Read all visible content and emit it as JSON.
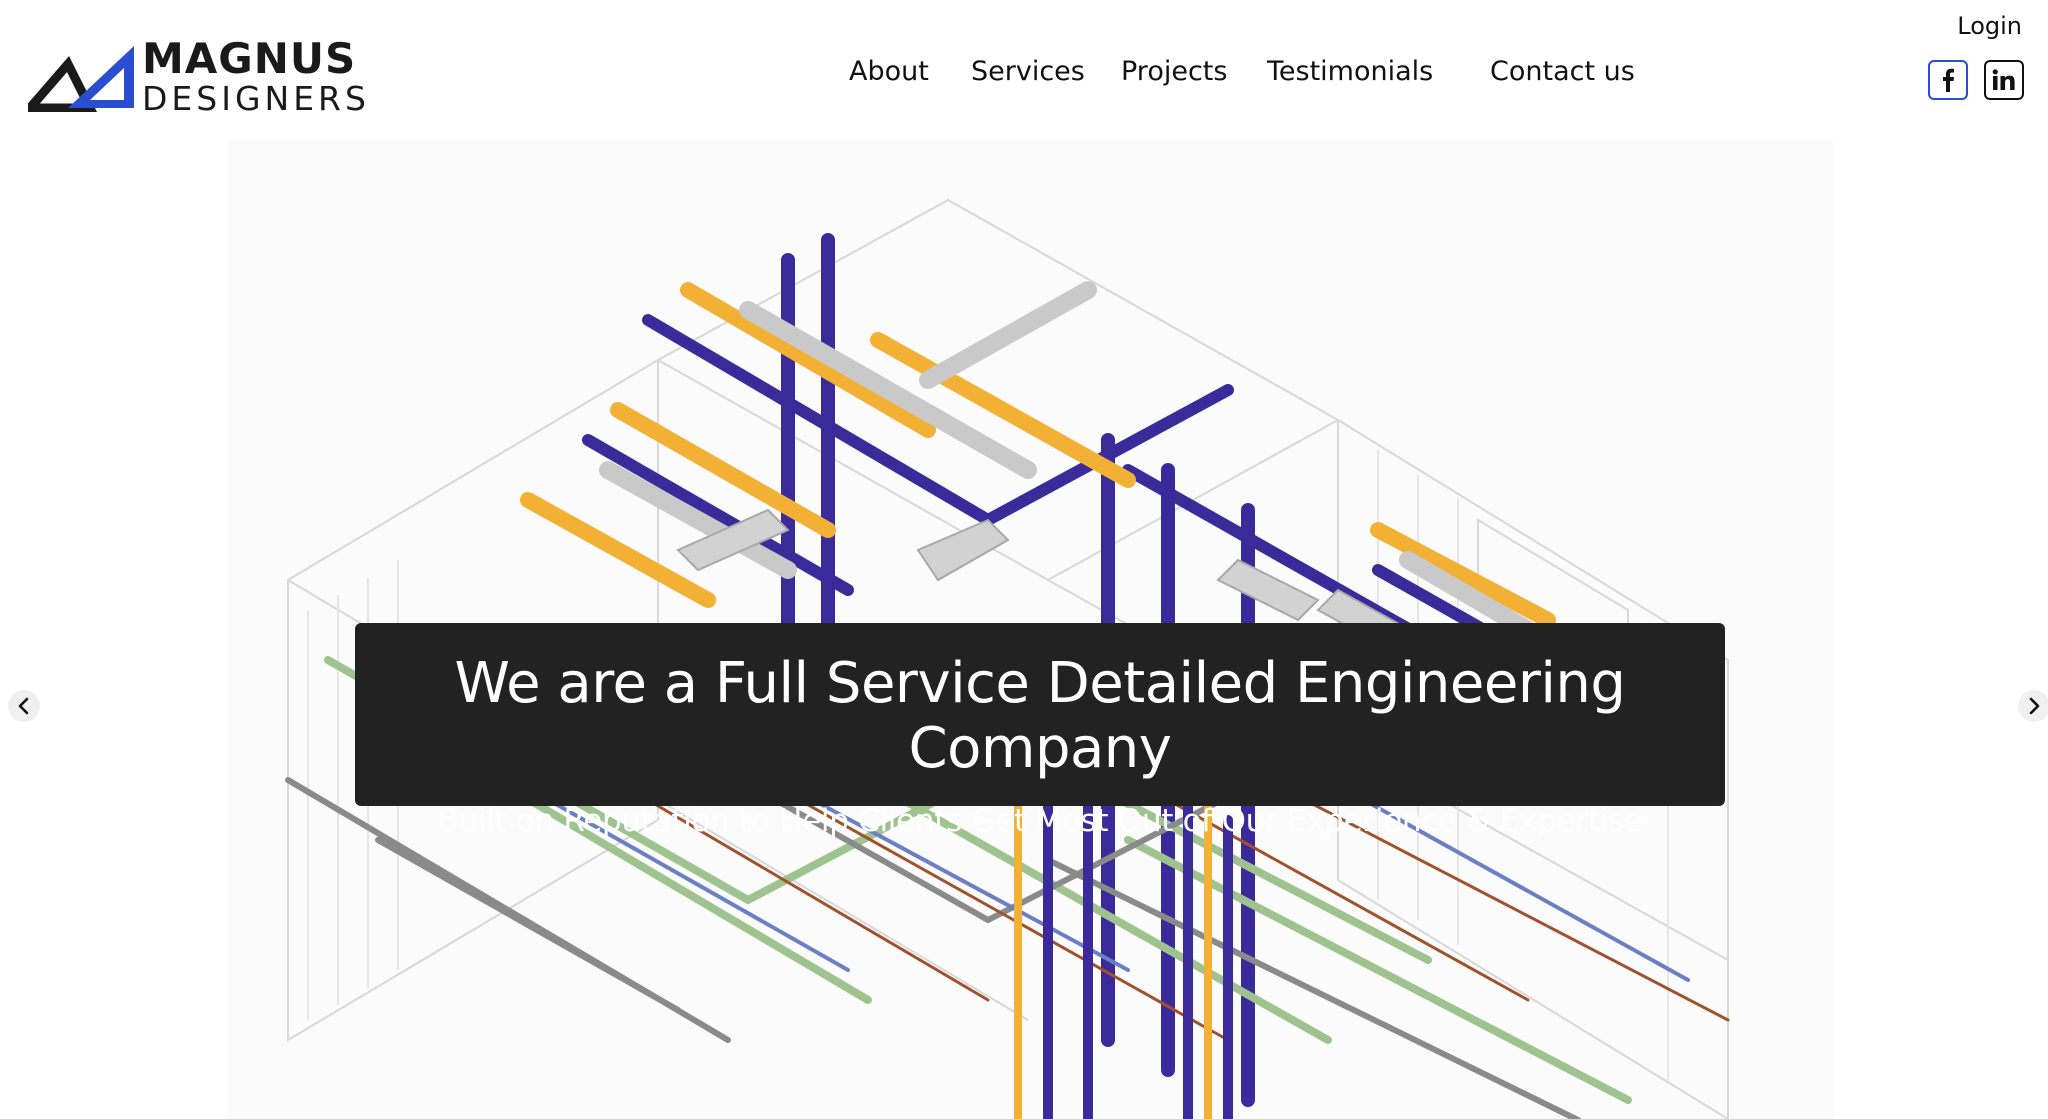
{
  "brand": {
    "line1": "MAGNUS",
    "line2": "DESIGNERS",
    "logo_icon": "triangle-logo-icon",
    "colors": {
      "dark": "#1a1a1a",
      "blue": "#2a4ecf"
    }
  },
  "nav": {
    "items": [
      {
        "label": "About"
      },
      {
        "label": "Services"
      },
      {
        "label": "Projects"
      },
      {
        "label": "Testimonials"
      },
      {
        "label": "Contact us"
      }
    ]
  },
  "header": {
    "login_label": "Login",
    "social": [
      {
        "icon": "facebook-icon"
      },
      {
        "icon": "linkedin-icon"
      }
    ]
  },
  "hero": {
    "image": "isometric-mep-building-model",
    "title": "We are a Full Service Detailed Engineering Company",
    "subtitle": "Built on Reputation to Help Clients Get Most Out of Our Experience & Expertise",
    "caption_bg": "#222222",
    "prev_icon": "chevron-left-icon",
    "next_icon": "chevron-right-icon"
  }
}
